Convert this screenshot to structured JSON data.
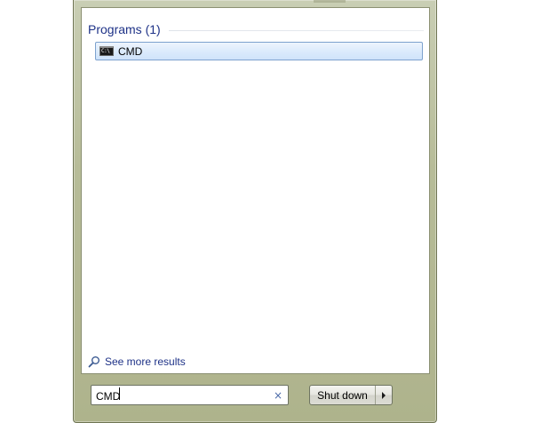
{
  "results": {
    "group_title": "Programs (1)",
    "items": [
      {
        "label": "CMD",
        "icon": "command-prompt-icon"
      }
    ]
  },
  "see_more": {
    "label": "See more results",
    "icon": "magnifier-icon"
  },
  "search": {
    "value": "CMD",
    "clear_glyph": "×"
  },
  "shutdown": {
    "label": "Shut down"
  },
  "colors": {
    "frame": "#b7bc98",
    "group_title": "#1e3287",
    "selection_border": "#7da2ce",
    "link": "#1e3287"
  }
}
